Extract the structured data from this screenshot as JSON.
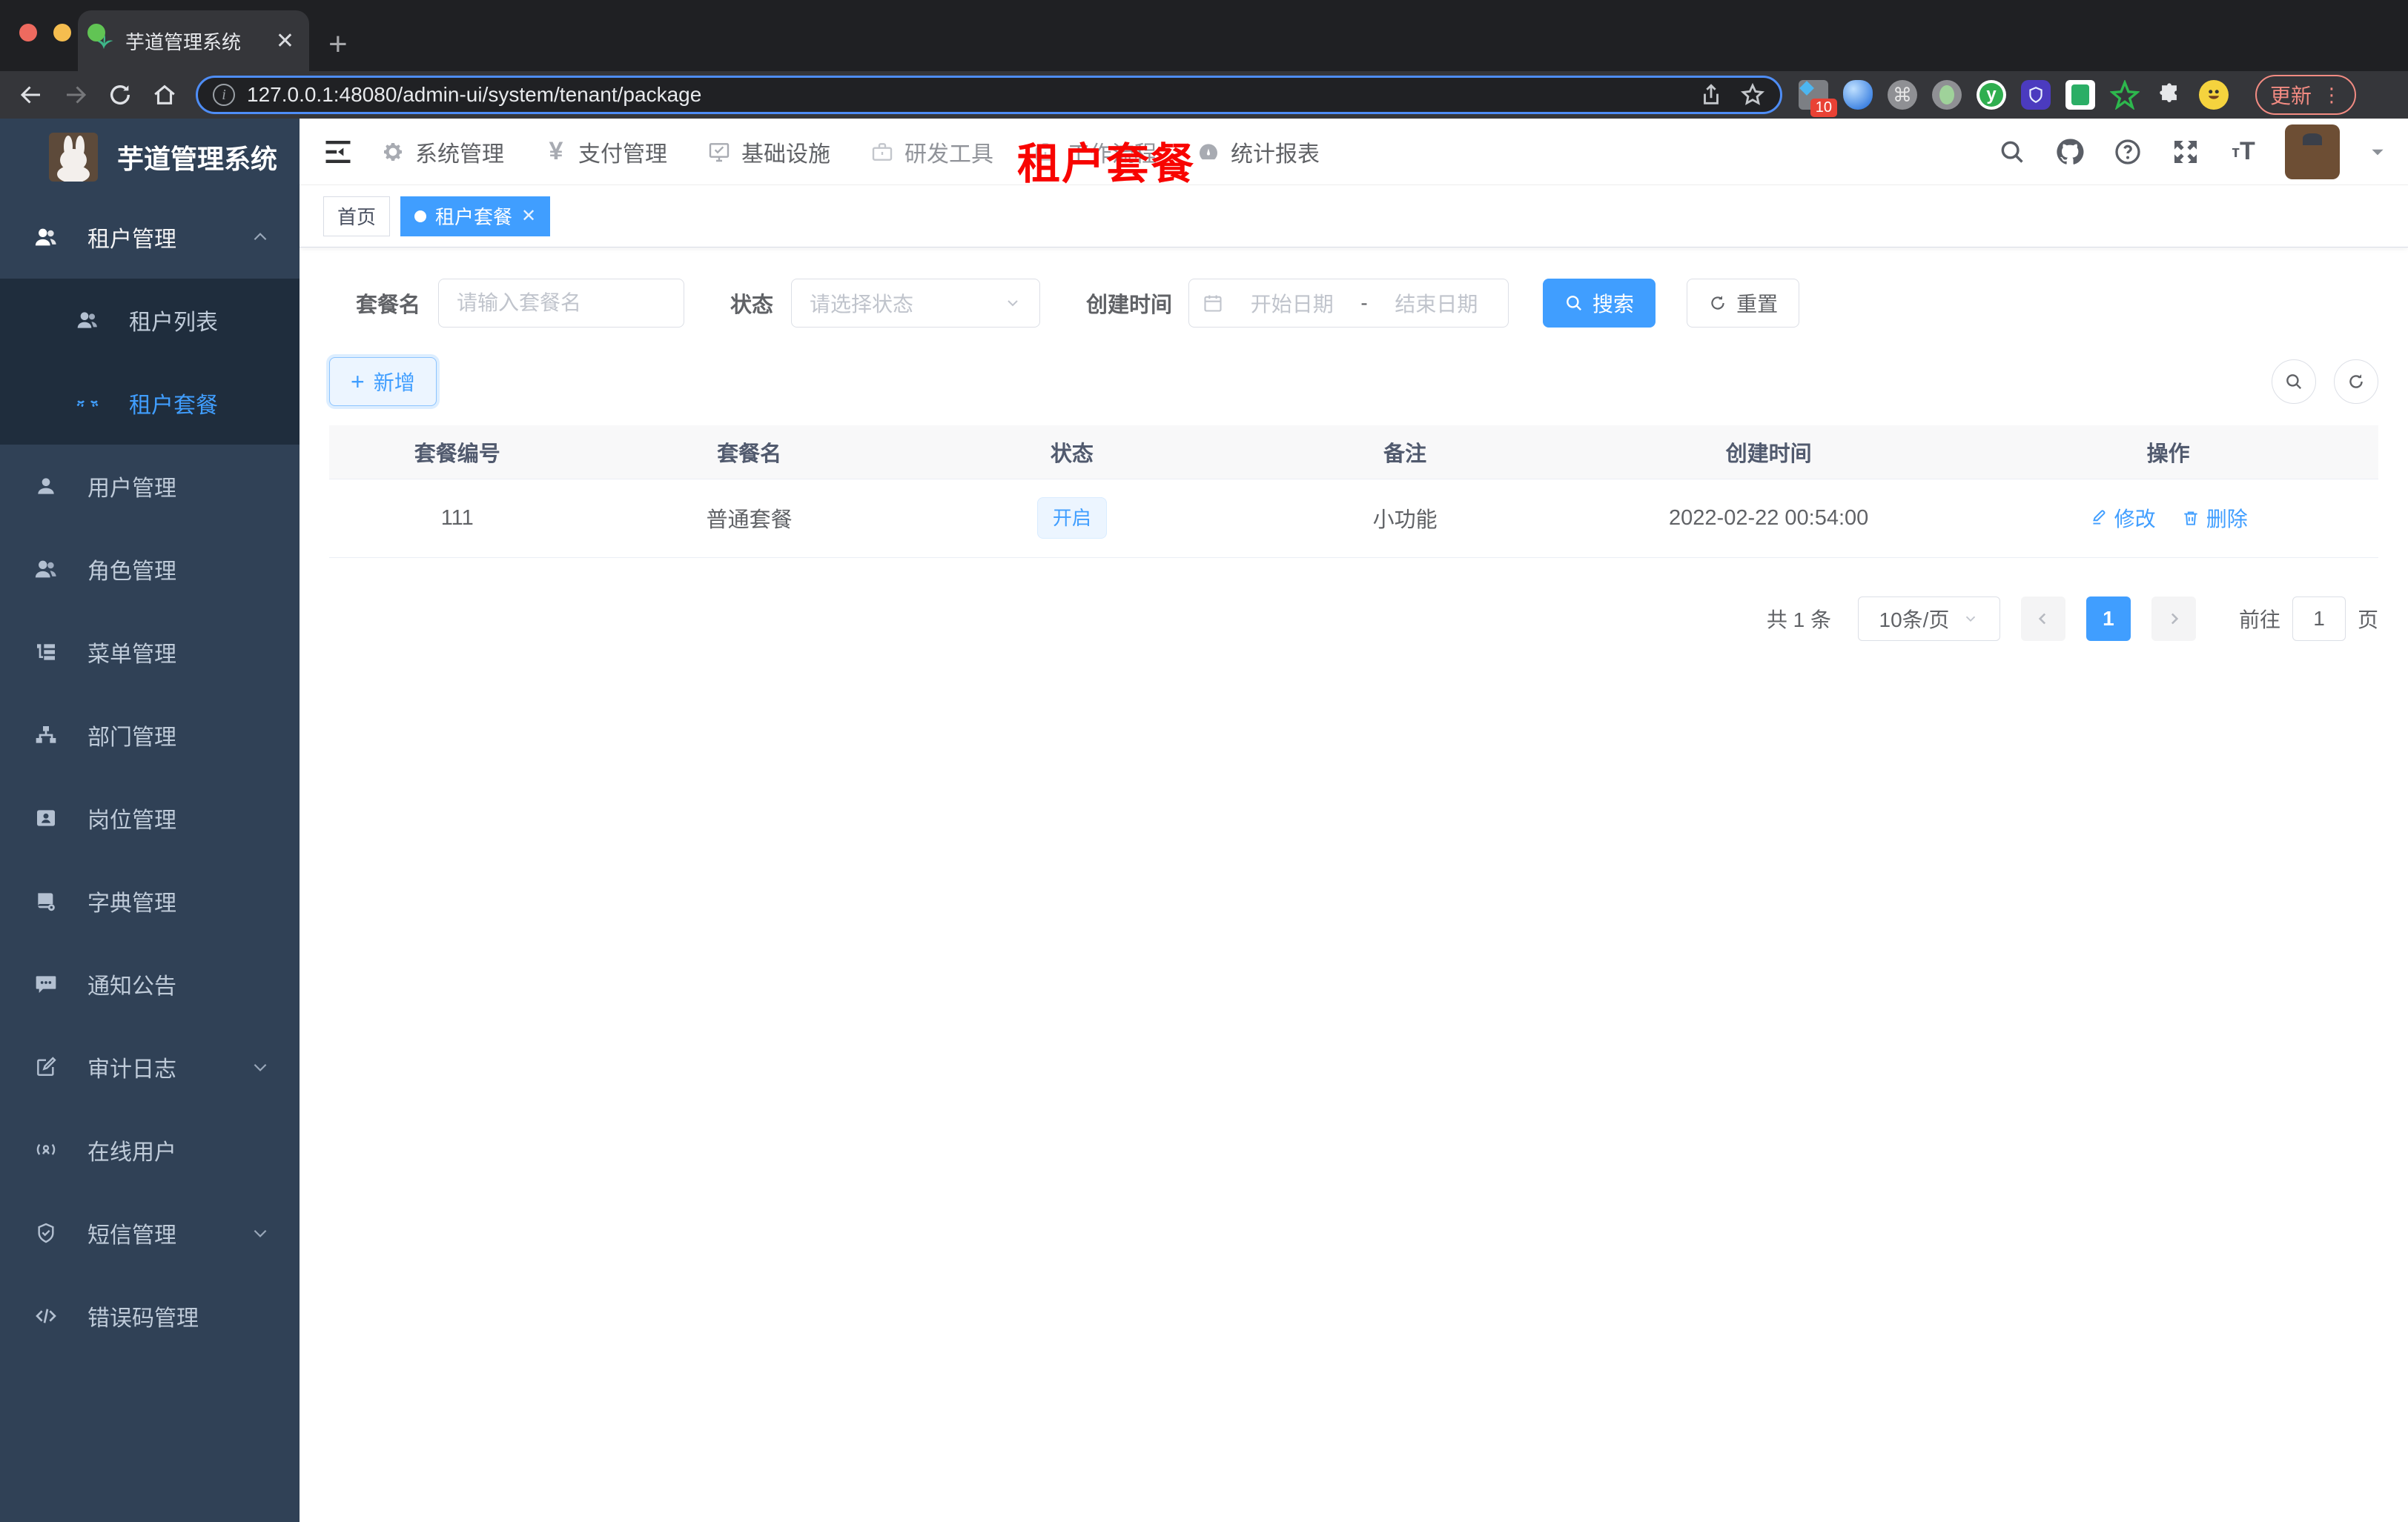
{
  "browser": {
    "tab_title": "芋道管理系统",
    "close_tab": "✕",
    "new_tab": "+",
    "url": "127.0.0.1:48080/admin-ui/system/tenant/package",
    "extension_badge": "10",
    "update_label": "更新",
    "kebab": "⋮"
  },
  "annotation": "租户套餐",
  "app_header": {
    "nav": [
      {
        "label": "系统管理"
      },
      {
        "label": "支付管理"
      },
      {
        "label": "基础设施"
      },
      {
        "label": "研发工具"
      },
      {
        "label": "工作流程"
      },
      {
        "label": "统计报表"
      }
    ]
  },
  "sidebar": {
    "logo_title": "芋道管理系统",
    "parent": {
      "label": "租户管理"
    },
    "submenu": [
      {
        "label": "租户列表"
      },
      {
        "label": "租户套餐"
      }
    ],
    "items": [
      {
        "label": "用户管理"
      },
      {
        "label": "角色管理"
      },
      {
        "label": "菜单管理"
      },
      {
        "label": "部门管理"
      },
      {
        "label": "岗位管理"
      },
      {
        "label": "字典管理"
      },
      {
        "label": "通知公告"
      },
      {
        "label": "审计日志"
      },
      {
        "label": "在线用户"
      },
      {
        "label": "短信管理"
      },
      {
        "label": "错误码管理"
      }
    ]
  },
  "tags": {
    "home": "首页",
    "active": "租户套餐"
  },
  "filters": {
    "name_label": "套餐名",
    "name_placeholder": "请输入套餐名",
    "status_label": "状态",
    "status_placeholder": "请选择状态",
    "time_label": "创建时间",
    "start_placeholder": "开始日期",
    "range_separator": "-",
    "end_placeholder": "结束日期",
    "search_label": "搜索",
    "reset_label": "重置"
  },
  "toolbar": {
    "add_label": "新增"
  },
  "table": {
    "headers": [
      "套餐编号",
      "套餐名",
      "状态",
      "备注",
      "创建时间",
      "操作"
    ],
    "rows": [
      {
        "id": "111",
        "name": "普通套餐",
        "status": "开启",
        "remark": "小功能",
        "created_at": "2022-02-22 00:54:00",
        "edit_label": "修改",
        "delete_label": "删除"
      }
    ]
  },
  "pagination": {
    "total": "共 1 条",
    "page_size": "10条/页",
    "page": "1",
    "goto_label": "前往",
    "goto_value": "1",
    "page_unit": "页"
  },
  "colors": {
    "accent": "#409eff",
    "sidebar_bg": "#304156",
    "submenu_bg": "#1f2d3d",
    "status_red": "#f80400"
  }
}
